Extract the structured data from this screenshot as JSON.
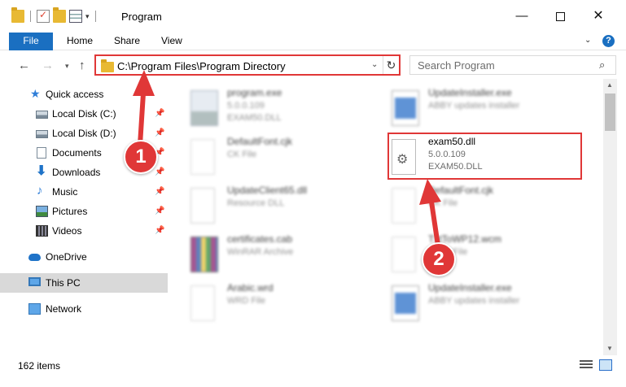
{
  "window": {
    "title": "Program",
    "minimize": "—",
    "close": "✕"
  },
  "ribbon": {
    "tabs": [
      "File",
      "Home",
      "Share",
      "View"
    ],
    "expand": "⌄",
    "help": "?"
  },
  "nav": {
    "back": "←",
    "forward": "→",
    "recent": "▾",
    "up": "↑",
    "address": "C:\\Program Files\\Program Directory",
    "address_dropdown": "⌄",
    "refresh": "↻",
    "search_placeholder": "Search Program",
    "search_icon": "⌕"
  },
  "sidebar": {
    "quick_access": "Quick access",
    "items": [
      {
        "label": "Local Disk (C:)",
        "pinned": true
      },
      {
        "label": "Local Disk (D:)",
        "pinned": true
      },
      {
        "label": "Documents",
        "pinned": true
      },
      {
        "label": "Downloads",
        "pinned": true
      },
      {
        "label": "Music",
        "pinned": true
      },
      {
        "label": "Pictures",
        "pinned": true
      },
      {
        "label": "Videos",
        "pinned": true
      }
    ],
    "onedrive": "OneDrive",
    "this_pc": "This PC",
    "network": "Network",
    "pin_glyph": "📌"
  },
  "files": [
    {
      "name": "program.exe",
      "line2": "5.0.0.109",
      "line3": "EXAM50.DLL",
      "icon": "exe-icon"
    },
    {
      "name": "UpdateInstaller.exe",
      "line2": "ABBY updates installer",
      "line3": "",
      "icon": "window-app-icon"
    },
    {
      "name": "DefaultFont.cjk",
      "line2": "CK File",
      "line3": "",
      "icon": "blank-file-icon"
    },
    {
      "name": "exam50.dll",
      "line2": "5.0.0.109",
      "line3": "EXAM50.DLL",
      "icon": "dll-gear-icon"
    },
    {
      "name": "UpdateClient65.dll",
      "line2": "Resource DLL",
      "line3": "",
      "icon": "dll-gear-icon"
    },
    {
      "name": "DefaultFont.cjk",
      "line2": "CK File",
      "line3": "",
      "icon": "blank-file-icon"
    },
    {
      "name": "certificates.cab",
      "line2": "WinRAR Archive",
      "line3": "",
      "icon": "winrar-archive-icon"
    },
    {
      "name": "TxtToWP12.wcm",
      "line2": "WCM File",
      "line3": "",
      "icon": "blank-file-icon"
    },
    {
      "name": "Arabic.wrd",
      "line2": "WRD File",
      "line3": "",
      "icon": "blank-file-icon"
    },
    {
      "name": "UpdateInstaller.exe",
      "line2": "ABBY updates installer",
      "line3": "",
      "icon": "window-app-icon"
    }
  ],
  "status": {
    "count": "162 items"
  },
  "annotations": {
    "step1": "1",
    "step2": "2",
    "color": "#e03737"
  },
  "colors": {
    "accent": "#1a6fc1",
    "highlight": "#e03737",
    "selected_nav": "#d9d9d9"
  }
}
